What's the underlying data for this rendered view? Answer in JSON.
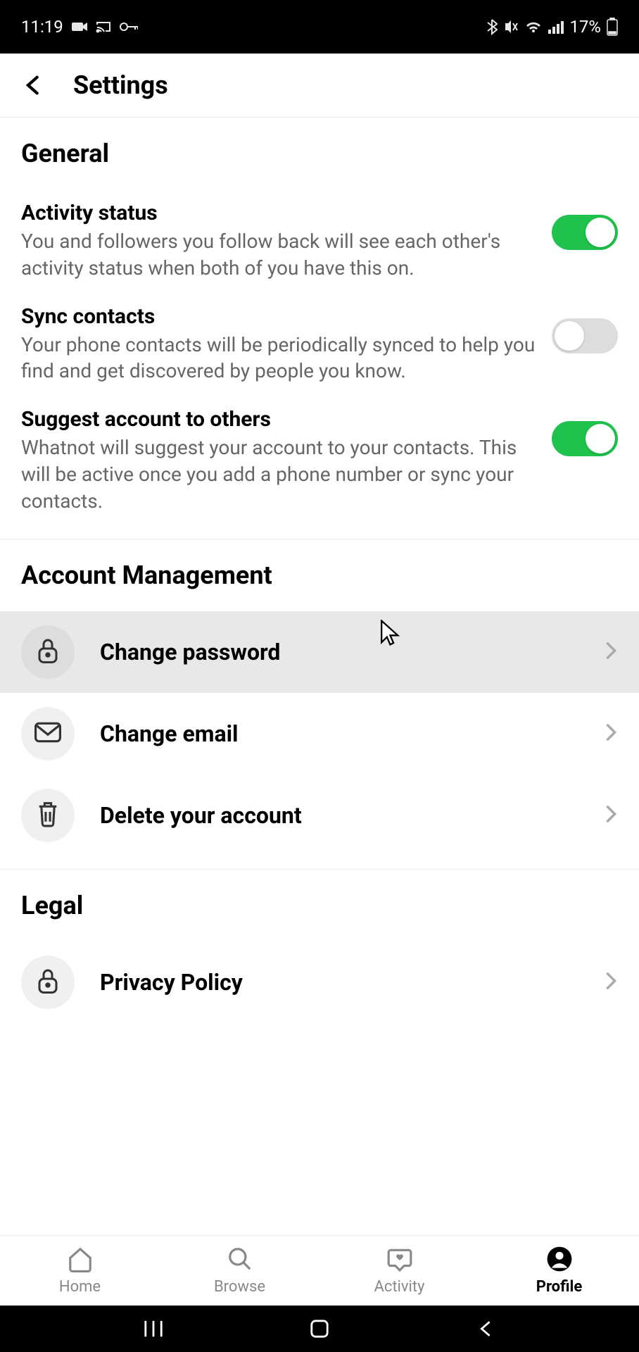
{
  "status_bar": {
    "time": "11:19",
    "battery": "17%"
  },
  "header": {
    "title": "Settings"
  },
  "sections": {
    "general": {
      "title": "General",
      "activity_status": {
        "title": "Activity status",
        "desc": "You and followers you follow back will see each other's activity status when both of you have this on.",
        "on": true
      },
      "sync_contacts": {
        "title": "Sync contacts",
        "desc": "Your phone contacts will be periodically synced to help you find and get discovered by people you know.",
        "on": false
      },
      "suggest_account": {
        "title": "Suggest account to others",
        "desc": "Whatnot will suggest your account to your contacts. This will be active once you add a phone number or sync your contacts.",
        "on": true
      }
    },
    "account_management": {
      "title": "Account Management",
      "change_password": "Change password",
      "change_email": "Change email",
      "delete_account": "Delete your account"
    },
    "legal": {
      "title": "Legal",
      "privacy_policy": "Privacy Policy"
    }
  },
  "bottom_nav": {
    "home": "Home",
    "browse": "Browse",
    "activity": "Activity",
    "profile": "Profile"
  }
}
